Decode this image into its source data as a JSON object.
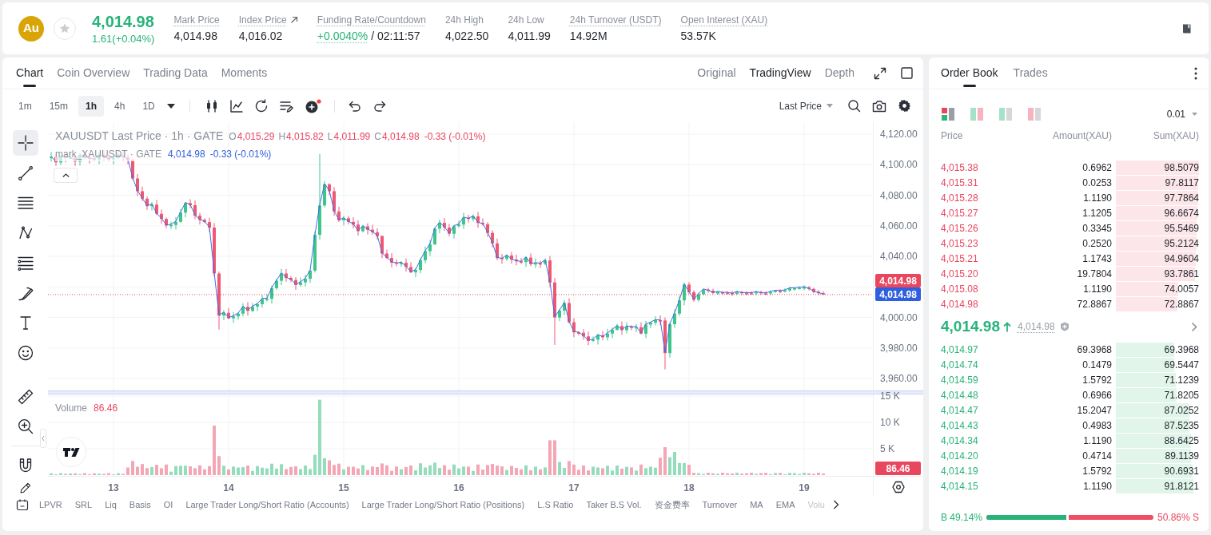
{
  "header": {
    "symbol_badge": "Au",
    "favorite": false,
    "price": "4,014.98",
    "change": "1.61(+0.04%)",
    "stats": [
      {
        "kind": "hint",
        "label": "Mark Price",
        "value": "4,014.98"
      },
      {
        "kind": "link",
        "label": "Index Price",
        "value": "4,016.02"
      },
      {
        "kind": "funding",
        "label": "Funding Rate/Countdown",
        "rate": "+0.0040%",
        "value": "/ 02:11:57"
      },
      {
        "kind": "plain",
        "label": "24h High",
        "value": "4,022.50"
      },
      {
        "kind": "plain",
        "label": "24h Low",
        "value": "4,011.99"
      },
      {
        "kind": "hint",
        "label": "24h Turnover (USDT)",
        "value": "14.92M"
      },
      {
        "kind": "hint",
        "label": "Open Interest (XAU)",
        "value": "53.57K"
      }
    ]
  },
  "chart": {
    "tabs": [
      {
        "label": "Chart",
        "selected": true
      },
      {
        "label": "Coin Overview",
        "selected": false
      },
      {
        "label": "Trading Data",
        "selected": false
      },
      {
        "label": "Moments",
        "selected": false
      }
    ],
    "views": [
      {
        "label": "Original",
        "selected": false
      },
      {
        "label": "TradingView",
        "selected": true
      },
      {
        "label": "Depth",
        "selected": false
      }
    ],
    "intervals": [
      {
        "label": "1m",
        "selected": false
      },
      {
        "label": "15m",
        "selected": false
      },
      {
        "label": "1h",
        "selected": true
      },
      {
        "label": "4h",
        "selected": false
      },
      {
        "label": "1D",
        "selected": false
      }
    ],
    "price_type": "Last Price",
    "tools": [
      [
        {
          "kind": "crosshair",
          "selected": true
        },
        {
          "kind": "line",
          "selected": false
        },
        {
          "kind": "lines",
          "selected": false
        },
        {
          "kind": "pattern",
          "selected": false
        },
        {
          "kind": "fib",
          "selected": false
        },
        {
          "kind": "brush",
          "selected": false
        },
        {
          "kind": "text",
          "selected": false
        },
        {
          "kind": "emoji",
          "selected": false
        }
      ],
      [
        {
          "kind": "ruler",
          "selected": false
        },
        {
          "kind": "zoom",
          "selected": false
        }
      ],
      [
        {
          "kind": "magnet",
          "selected": false
        },
        {
          "kind": "pencil",
          "selected": false
        }
      ]
    ],
    "legend": {
      "title": "XAUUSDT Last Price · 1h · GATE",
      "ohlc": [
        {
          "key": "O",
          "value": "4,015.29"
        },
        {
          "key": "H",
          "value": "4,015.82"
        },
        {
          "key": "L",
          "value": "4,011.99"
        },
        {
          "key": "C",
          "value": "4,014.98"
        }
      ],
      "change": "-0.33 (-0.01%)",
      "mark_title": "mark_XAUUSDT · GATE",
      "mark_value": "4,014.98",
      "mark_change": "-0.33 (-0.01%)"
    },
    "price_axis": {
      "upper": [
        "4,120.00",
        "4,100.00",
        "4,080.00",
        "4,060.00",
        "4,040.00"
      ],
      "lower": [
        "4,000.00",
        "3,980.00",
        "3,960.00"
      ]
    },
    "price_tags": [
      {
        "text": "4,014.98",
        "color": "#e9475e"
      },
      {
        "text": "4,014.98",
        "color": "#2f5fdf"
      }
    ],
    "volume": {
      "label": "Volume",
      "value": "86.46",
      "axis": [
        "15 K",
        "10 K",
        "5 K"
      ],
      "tag": "86.46"
    },
    "dates": [
      "13",
      "14",
      "15",
      "16",
      "17",
      "18",
      "19"
    ],
    "indicators": [
      "LPVR",
      "SRL",
      "Liq",
      "Basis",
      "OI",
      "Large Trader Long/Short Ratio (Accounts)",
      "Large Trader Long/Short Ratio (Positions)",
      "L.S Ratio",
      "Taker B.S Vol.",
      "资金费率",
      "Turnover",
      "MA",
      "EMA",
      "Volu"
    ]
  },
  "order_book": {
    "tabs": [
      {
        "label": "Order Book",
        "selected": true
      },
      {
        "label": "Trades",
        "selected": false
      }
    ],
    "layouts": [
      {
        "kind": "all",
        "selected": true
      },
      {
        "kind": "split",
        "selected": false
      },
      {
        "kind": "bids",
        "selected": false
      },
      {
        "kind": "asks",
        "selected": false
      }
    ],
    "precision": "0.01",
    "columns": [
      "Price",
      "Amount(XAU)",
      "Sum(XAU)"
    ],
    "asks": [
      {
        "price": "4,015.38",
        "amount": "0.6962",
        "sum": "98.5079"
      },
      {
        "price": "4,015.31",
        "amount": "0.0253",
        "sum": "97.8117"
      },
      {
        "price": "4,015.28",
        "amount": "1.1190",
        "sum": "97.7864"
      },
      {
        "price": "4,015.27",
        "amount": "1.1205",
        "sum": "96.6674"
      },
      {
        "price": "4,015.26",
        "amount": "0.3345",
        "sum": "95.5469"
      },
      {
        "price": "4,015.23",
        "amount": "0.2520",
        "sum": "95.2124"
      },
      {
        "price": "4,015.21",
        "amount": "1.1743",
        "sum": "94.9604"
      },
      {
        "price": "4,015.20",
        "amount": "19.7804",
        "sum": "93.7861"
      },
      {
        "price": "4,015.08",
        "amount": "1.1190",
        "sum": "74.0057"
      },
      {
        "price": "4,014.98",
        "amount": "72.8867",
        "sum": "72.8867"
      }
    ],
    "last_price": "4,014.98",
    "mark_price": "4,014.98",
    "bids": [
      {
        "price": "4,014.97",
        "amount": "69.3968",
        "sum": "69.3968"
      },
      {
        "price": "4,014.74",
        "amount": "0.1479",
        "sum": "69.5447"
      },
      {
        "price": "4,014.59",
        "amount": "1.5792",
        "sum": "71.1239"
      },
      {
        "price": "4,014.48",
        "amount": "0.6966",
        "sum": "71.8205"
      },
      {
        "price": "4,014.47",
        "amount": "15.2047",
        "sum": "87.0252"
      },
      {
        "price": "4,014.43",
        "amount": "0.4983",
        "sum": "87.5235"
      },
      {
        "price": "4,014.34",
        "amount": "1.1190",
        "sum": "88.6425"
      },
      {
        "price": "4,014.20",
        "amount": "0.4714",
        "sum": "89.1139"
      },
      {
        "price": "4,014.19",
        "amount": "1.5792",
        "sum": "90.6931"
      },
      {
        "price": "4,014.15",
        "amount": "1.1190",
        "sum": "91.8121"
      }
    ],
    "buy_ratio": "B 49.14%",
    "sell_ratio": "50.86% S",
    "level": 0.4914
  }
}
